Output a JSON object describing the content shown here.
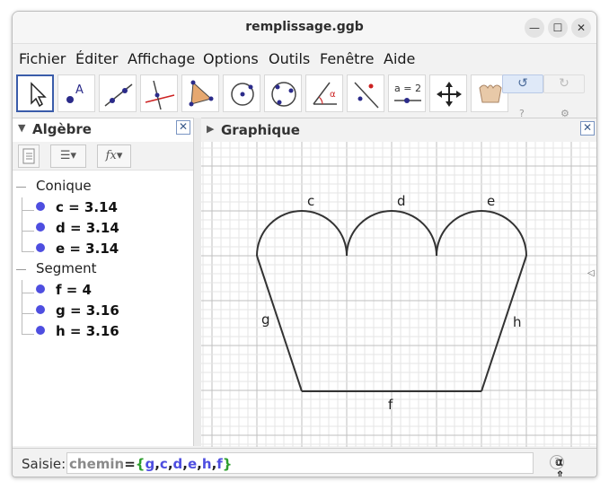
{
  "window": {
    "title": "remplissage.ggb"
  },
  "menubar": {
    "items": [
      "Fichier",
      "Éditer",
      "Affichage",
      "Options",
      "Outils",
      "Fenêtre",
      "Aide"
    ]
  },
  "toolbar": {
    "tools": [
      "move-icon",
      "point-icon",
      "line-icon",
      "perpendicular-icon",
      "polygon-icon",
      "circle-center-icon",
      "circle-three-points-icon",
      "angle-icon",
      "reflect-icon",
      "slider-icon",
      "move-graphics-icon",
      "crown-icon"
    ],
    "slider_label": "a = 2",
    "undo_icon": "↺",
    "redo_icon": "↻",
    "help_icon": "?",
    "settings_icon": "⚙"
  },
  "algebra": {
    "title": "Algèbre",
    "close": "✕",
    "groups": [
      {
        "label": "Conique",
        "items": [
          "c = 3.14",
          "d = 3.14",
          "e = 3.14"
        ]
      },
      {
        "label": "Segment",
        "items": [
          "f = 4",
          "g = 3.16",
          "h = 3.16"
        ]
      }
    ],
    "toolbar_fx": "fx"
  },
  "graphics": {
    "title": "Graphique",
    "close": "✕",
    "labels": {
      "c": "c",
      "d": "d",
      "e": "e",
      "f": "f",
      "g": "g",
      "h": "h"
    }
  },
  "inputbar": {
    "label": "Saisie:",
    "command": "chemin",
    "equals": "=",
    "open_brace": "{",
    "args": [
      "g",
      "c",
      "d",
      "e",
      "h",
      "f"
    ],
    "close_brace": "}",
    "alpha": "α",
    "help": "?"
  },
  "colors": {
    "object_dot": "#4e4ee0",
    "accent": "#3a5caa",
    "curve": "#333333",
    "grid_major": "#bfbfbf",
    "grid_minor": "#e6e6e6"
  }
}
